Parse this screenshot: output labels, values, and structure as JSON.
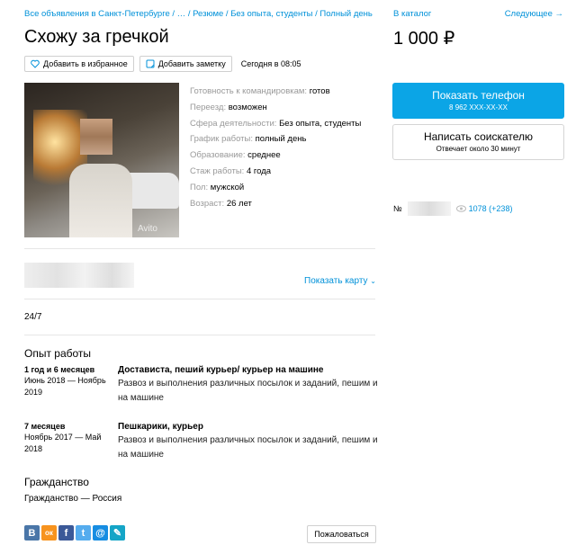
{
  "breadcrumbs": "Все объявления в Санкт-Петербурге / … / Резюме / Без опыта, студенты / Полный день",
  "nav": {
    "catalog": "В каталог",
    "next": "Следующее →"
  },
  "title": "Схожу за гречкой",
  "price": "1 000 ₽",
  "actions": {
    "favorite": "Добавить в избранное",
    "note": "Добавить заметку",
    "date": "Сегодня в 08:05"
  },
  "photo": {
    "watermark": "Avito"
  },
  "params": [
    {
      "key": "Готовность к командировкам:",
      "value": "готов"
    },
    {
      "key": "Переезд:",
      "value": "возможен"
    },
    {
      "key": "Сфера деятельности:",
      "value": "Без опыта, студенты"
    },
    {
      "key": "График работы:",
      "value": "полный день"
    },
    {
      "key": "Образование:",
      "value": "среднее"
    },
    {
      "key": "Стаж работы:",
      "value": "4 года"
    },
    {
      "key": "Пол:",
      "value": "мужской"
    },
    {
      "key": "Возраст:",
      "value": "26 лет"
    }
  ],
  "contact": {
    "phone_label": "Показать телефон",
    "phone_number": "8 962 XXX-XX-XX",
    "write_label": "Написать соискателю",
    "write_sub": "Отвечает около 30 минут"
  },
  "meta": {
    "no_label": "№",
    "views": "1078 (+238)"
  },
  "map_link": "Показать карту",
  "schedule": "24/7",
  "experience": {
    "title": "Опыт работы",
    "jobs": [
      {
        "duration": "1 год и 6 месяцев",
        "period": "Июнь 2018 — Ноябрь 2019",
        "position": "Достависта, пеший курьер/ курьер на машине",
        "description": "Развоз и выполнения различных посылок и заданий, пешим и на машине"
      },
      {
        "duration": "7 месяцев",
        "period": "Ноябрь 2017 — Май 2018",
        "position": "Пешкарики, курьер",
        "description": "Развоз и выполнения различных посылок и заданий, пешим и на машине"
      }
    ]
  },
  "citizenship": {
    "title": "Гражданство",
    "value": "Гражданство — Россия"
  },
  "social": [
    {
      "icon": "vk-icon",
      "glyph": "B",
      "color": "#4a76a8"
    },
    {
      "icon": "ok-icon",
      "glyph": "ок",
      "color": "#f7931e"
    },
    {
      "icon": "facebook-icon",
      "glyph": "f",
      "color": "#3b5998"
    },
    {
      "icon": "twitter-icon",
      "glyph": "t",
      "color": "#55acee"
    },
    {
      "icon": "mail-icon",
      "glyph": "@",
      "color": "#168de2"
    },
    {
      "icon": "livejournal-icon",
      "glyph": "✎",
      "color": "#15a5c7"
    }
  ],
  "report": "Пожаловаться"
}
